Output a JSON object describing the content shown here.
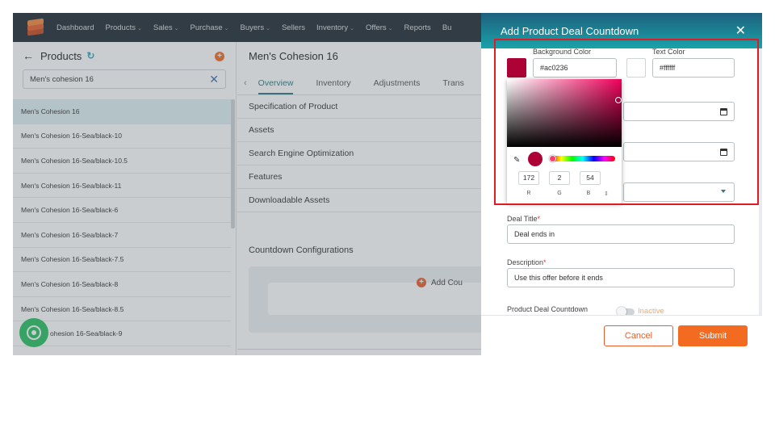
{
  "nav": {
    "items": [
      {
        "label": "Dashboard",
        "chev": ""
      },
      {
        "label": "Products",
        "chev": "⌄"
      },
      {
        "label": "Sales",
        "chev": "⌄"
      },
      {
        "label": "Purchase",
        "chev": "⌄"
      },
      {
        "label": "Buyers",
        "chev": "⌄"
      },
      {
        "label": "Sellers",
        "chev": ""
      },
      {
        "label": "Inventory",
        "chev": "⌄"
      },
      {
        "label": "Offers",
        "chev": "⌄"
      },
      {
        "label": "Reports",
        "chev": ""
      },
      {
        "label": "Bu",
        "chev": ""
      }
    ]
  },
  "sidebar": {
    "title": "Products",
    "search_value": "Men's cohesion 16",
    "items": [
      "Men's Cohesion 16",
      "Men's Cohesion 16-Sea/black-10",
      "Men's Cohesion 16-Sea/black-10.5",
      "Men's Cohesion 16-Sea/black-11",
      "Men's Cohesion 16-Sea/black-6",
      "Men's Cohesion 16-Sea/black-7",
      "Men's Cohesion 16-Sea/black-7.5",
      "Men's Cohesion 16-Sea/black-8",
      "Men's Cohesion 16-Sea/black-8.5",
      "ohesion 16-Sea/black-9"
    ]
  },
  "main": {
    "title": "Men's Cohesion 16",
    "tabs": [
      "Overview",
      "Inventory",
      "Adjustments",
      "Trans"
    ],
    "sections": [
      "Specification of Product",
      "Assets",
      "Search Engine Optimization",
      "Features",
      "Downloadable Assets"
    ],
    "countdown_title": "Countdown Configurations",
    "add_countdown": "Add Cou"
  },
  "drawer": {
    "title": "Add Product Deal Countdown",
    "close": "✕",
    "bg_color_label": "Background Color",
    "bg_color_value": "#ac0236",
    "text_color_label": "Text Color",
    "text_color_value": "#ffffff",
    "picker": {
      "r": "172",
      "g": "2",
      "b": "54",
      "r_label": "R",
      "g_label": "G",
      "b_label": "B",
      "toggle": "⇕"
    },
    "deal_title_label": "Deal Title",
    "deal_title_value": "Deal ends in",
    "description_label": "Description",
    "description_value": "Use this offer before it ends",
    "status_label": "Product Deal Countdown",
    "status_value": "Inactive",
    "required_mark": "*",
    "cancel": "Cancel",
    "submit": "Submit"
  },
  "colors": {
    "accent": "#f26b21",
    "teal": "#2b7a82",
    "picked": "#ac0236",
    "highlight": "#e01b24"
  }
}
